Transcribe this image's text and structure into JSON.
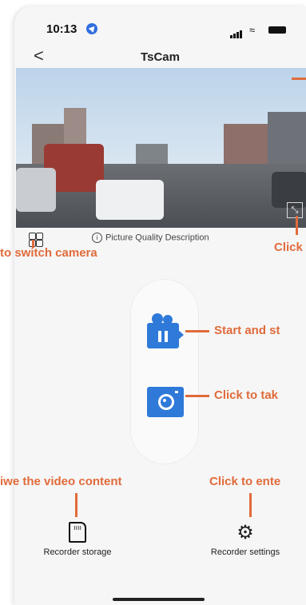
{
  "status_bar": {
    "time": "10:13"
  },
  "nav": {
    "back_label": "<",
    "title": "TsCam"
  },
  "video": {
    "expand_label": "⤡"
  },
  "picture_quality": {
    "info_label": "i",
    "label": "Picture Quality Description"
  },
  "controls": {
    "record": "Start and stop recording",
    "photo": "Click to take photo"
  },
  "bottom": {
    "storage_label": "Recorder storage",
    "settings_label": "Recorder settings"
  },
  "annotations": {
    "switch_camera": "to switch camera",
    "expand": "Click",
    "record": "Start and st",
    "photo": "Click to tak",
    "video_content": "iwe the video content",
    "settings": "Click to ente"
  },
  "colors": {
    "accent": "#e06b3b",
    "button_blue": "#2f7ad9"
  }
}
